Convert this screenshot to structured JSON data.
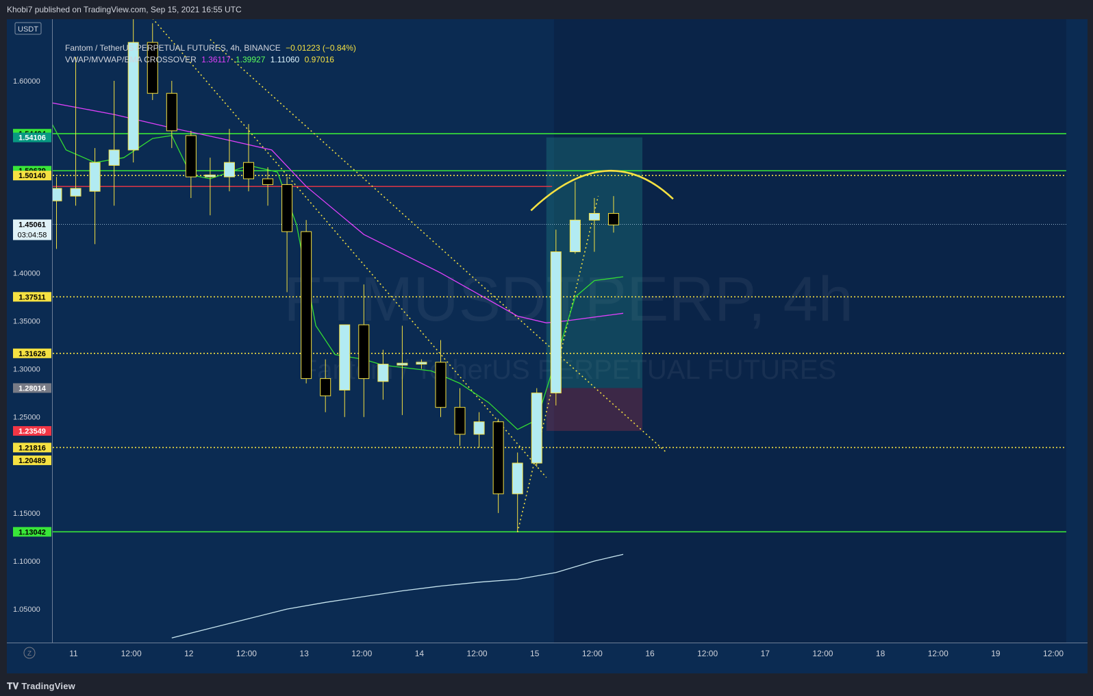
{
  "header": {
    "published": "Khobi7 published on TradingView.com, Sep 15, 2021 16:55 UTC"
  },
  "legend": {
    "currency_badge": "USDT",
    "symbol_line": "Fantom / TetherUS PERPETUAL FUTURES, 4h, BINANCE",
    "change": "−0.01223 (−0.84%)",
    "indicator_name": "VWAP/MVWAP/EMA CROSSOVER",
    "ind_v1": "1.36117",
    "ind_v2": "1.39927",
    "ind_v3": "1.11060",
    "ind_v4": "0.97016"
  },
  "watermark": {
    "symbol": "FTMUSDTPERP, 4h",
    "name": "Fantom / TetherUS PERPETUAL FUTURES"
  },
  "footer": {
    "brand": "TradingView",
    "zoom_label": "Z"
  },
  "colors": {
    "background": "#1e222d",
    "chart_bg": "#0b2b52",
    "candle_up": "#b2ebf2",
    "candle_down": "#000000",
    "candle_border": "#f5e142",
    "vwap": "#e040fb",
    "ema": "#33dd33",
    "mvwap": "#c8e6f0",
    "level_green": "#39e639",
    "level_red": "#f23645",
    "level_yellow": "#f5e142"
  },
  "chart_data": {
    "type": "candlestick",
    "interval": "4h",
    "ylim": [
      1.02,
      1.66
    ],
    "y_ticks": [
      "1.60000",
      "1.40000",
      "1.35000",
      "1.30000",
      "1.25000",
      "1.15000",
      "1.10000",
      "1.05000"
    ],
    "x_ticks": [
      "11",
      "12:00",
      "12",
      "12:00",
      "13",
      "12:00",
      "14",
      "12:00",
      "15",
      "12:00",
      "16",
      "12:00",
      "17",
      "12:00",
      "18",
      "12:00",
      "19",
      "12:00"
    ],
    "candles": [
      {
        "t": 0,
        "o": 1.475,
        "h": 1.5,
        "l": 1.425,
        "c": 1.488
      },
      {
        "t": 1,
        "o": 1.48,
        "h": 1.625,
        "l": 1.47,
        "c": 1.488
      },
      {
        "t": 2,
        "o": 1.485,
        "h": 1.53,
        "l": 1.43,
        "c": 1.515
      },
      {
        "t": 3,
        "o": 1.512,
        "h": 1.6,
        "l": 1.47,
        "c": 1.528
      },
      {
        "t": 4,
        "o": 1.528,
        "h": 1.675,
        "l": 1.515,
        "c": 1.64
      },
      {
        "t": 5,
        "o": 1.64,
        "h": 1.66,
        "l": 1.58,
        "c": 1.587
      },
      {
        "t": 6,
        "o": 1.587,
        "h": 1.6,
        "l": 1.53,
        "c": 1.548
      },
      {
        "t": 7,
        "o": 1.543,
        "h": 1.548,
        "l": 1.478,
        "c": 1.5
      },
      {
        "t": 8,
        "o": 1.5,
        "h": 1.52,
        "l": 1.46,
        "c": 1.502
      },
      {
        "t": 9,
        "o": 1.5,
        "h": 1.55,
        "l": 1.485,
        "c": 1.515
      },
      {
        "t": 10,
        "o": 1.515,
        "h": 1.555,
        "l": 1.485,
        "c": 1.498
      },
      {
        "t": 11,
        "o": 1.498,
        "h": 1.51,
        "l": 1.47,
        "c": 1.492
      },
      {
        "t": 12,
        "o": 1.492,
        "h": 1.5,
        "l": 1.38,
        "c": 1.443
      },
      {
        "t": 13,
        "o": 1.443,
        "h": 1.455,
        "l": 1.285,
        "c": 1.29
      },
      {
        "t": 14,
        "o": 1.29,
        "h": 1.31,
        "l": 1.255,
        "c": 1.272
      },
      {
        "t": 15,
        "o": 1.278,
        "h": 1.345,
        "l": 1.25,
        "c": 1.346
      },
      {
        "t": 16,
        "o": 1.346,
        "h": 1.388,
        "l": 1.25,
        "c": 1.29
      },
      {
        "t": 17,
        "o": 1.287,
        "h": 1.32,
        "l": 1.268,
        "c": 1.305
      },
      {
        "t": 18,
        "o": 1.304,
        "h": 1.345,
        "l": 1.252,
        "c": 1.306
      },
      {
        "t": 19,
        "o": 1.305,
        "h": 1.31,
        "l": 1.3,
        "c": 1.307
      },
      {
        "t": 20,
        "o": 1.307,
        "h": 1.33,
        "l": 1.25,
        "c": 1.26
      },
      {
        "t": 21,
        "o": 1.26,
        "h": 1.28,
        "l": 1.22,
        "c": 1.232
      },
      {
        "t": 22,
        "o": 1.232,
        "h": 1.255,
        "l": 1.218,
        "c": 1.245
      },
      {
        "t": 23,
        "o": 1.245,
        "h": 1.248,
        "l": 1.15,
        "c": 1.17
      },
      {
        "t": 24,
        "o": 1.17,
        "h": 1.213,
        "l": 1.13,
        "c": 1.202
      },
      {
        "t": 25,
        "o": 1.202,
        "h": 1.28,
        "l": 1.198,
        "c": 1.275
      },
      {
        "t": 26,
        "o": 1.275,
        "h": 1.445,
        "l": 1.262,
        "c": 1.422
      },
      {
        "t": 27,
        "o": 1.422,
        "h": 1.495,
        "l": 1.42,
        "c": 1.455
      },
      {
        "t": 28,
        "o": 1.455,
        "h": 1.478,
        "l": 1.422,
        "c": 1.462
      },
      {
        "t": 29,
        "o": 1.462,
        "h": 1.48,
        "l": 1.442,
        "c": 1.45
      }
    ],
    "series": [
      {
        "name": "VWAP",
        "color": "#e040fb",
        "points": [
          [
            -0.5,
            1.578
          ],
          [
            3,
            1.565
          ],
          [
            6,
            1.551
          ],
          [
            9,
            1.538
          ],
          [
            11.2,
            1.528
          ],
          [
            13,
            1.49
          ],
          [
            16,
            1.44
          ],
          [
            20,
            1.4
          ],
          [
            24,
            1.355
          ],
          [
            25.5,
            1.348
          ],
          [
            26.5,
            1.35
          ],
          [
            29.5,
            1.358
          ]
        ]
      },
      {
        "name": "EMA",
        "color": "#33dd33",
        "points": [
          [
            -0.5,
            1.565
          ],
          [
            0.5,
            1.528
          ],
          [
            2,
            1.515
          ],
          [
            3.5,
            1.52
          ],
          [
            5,
            1.54
          ],
          [
            6,
            1.543
          ],
          [
            7,
            1.502
          ],
          [
            8,
            1.498
          ],
          [
            10,
            1.512
          ],
          [
            11.5,
            1.505
          ],
          [
            12.5,
            1.45
          ],
          [
            13.5,
            1.345
          ],
          [
            14.5,
            1.315
          ],
          [
            16,
            1.31
          ],
          [
            17,
            1.304
          ],
          [
            19.5,
            1.298
          ],
          [
            21,
            1.285
          ],
          [
            22.5,
            1.265
          ],
          [
            24,
            1.237
          ],
          [
            25,
            1.247
          ],
          [
            26,
            1.31
          ],
          [
            27,
            1.375
          ],
          [
            28,
            1.392
          ],
          [
            29.5,
            1.396
          ]
        ]
      },
      {
        "name": "MVWAP",
        "color": "#c8e6f0",
        "points": [
          [
            6,
            1.02
          ],
          [
            8,
            1.03
          ],
          [
            10,
            1.04
          ],
          [
            12,
            1.05
          ],
          [
            14,
            1.057
          ],
          [
            16,
            1.063
          ],
          [
            18,
            1.069
          ],
          [
            20,
            1.074
          ],
          [
            22,
            1.078
          ],
          [
            24,
            1.081
          ],
          [
            26,
            1.088
          ],
          [
            28,
            1.1
          ],
          [
            29.5,
            1.107
          ]
        ]
      }
    ],
    "levels": [
      {
        "price": 1.54494,
        "label": "1.54494",
        "style": "solid",
        "color": "#39e639",
        "label_bg": "#39e639",
        "label_fg": "#000000"
      },
      {
        "price": 1.54106,
        "label": "1.54106",
        "style": "badge",
        "label_bg": "#089981",
        "label_fg": "#ffffff"
      },
      {
        "price": 1.50639,
        "label": "1.50639",
        "style": "solid",
        "color": "#39e639",
        "label_bg": "#39e639",
        "label_fg": "#000000"
      },
      {
        "price": 1.5014,
        "label": "1.50140",
        "style": "dotted",
        "color": "#f5e142",
        "label_bg": "#f5e142",
        "label_fg": "#000000"
      },
      {
        "price": 1.45061,
        "label": "1.45061",
        "style": "fine-dotted",
        "color": "#a8c8e0",
        "label_bg": "#e0f2f7",
        "label_fg": "#000000",
        "sublabel": "03:04:58"
      },
      {
        "price": 1.37511,
        "label": "1.37511",
        "style": "dotted",
        "color": "#f5e142",
        "label_bg": "#f5e142",
        "label_fg": "#000000"
      },
      {
        "price": 1.31626,
        "label": "1.31626",
        "style": "dotted",
        "color": "#f5e142",
        "label_bg": "#f5e142",
        "label_fg": "#000000"
      },
      {
        "price": 1.28014,
        "label": "1.28014",
        "style": "badge",
        "label_bg": "#787b86",
        "label_fg": "#ffffff"
      },
      {
        "price": 1.23549,
        "label": "1.23549",
        "style": "badge",
        "label_bg": "#f23645",
        "label_fg": "#ffffff"
      },
      {
        "price": 1.21816,
        "label": "1.21816",
        "style": "dotted",
        "color": "#f5e142",
        "label_bg": "#f5e142",
        "label_fg": "#000000"
      },
      {
        "price": 1.20489,
        "label": "1.20489",
        "style": "badge",
        "label_bg": "#f5e142",
        "label_fg": "#000000"
      },
      {
        "price": 1.13042,
        "label": "1.13042",
        "style": "solid",
        "color": "#39e639",
        "label_bg": "#39e639",
        "label_fg": "#000000"
      }
    ],
    "red_level": {
      "price": 1.49,
      "from_t": -0.5,
      "to_t": 25.8
    },
    "position_tool": {
      "from_t": 25.5,
      "to_t": 30.5,
      "entry": 1.28014,
      "target": 1.54106,
      "stop": 1.23549
    },
    "trendlines": [
      {
        "from": [
          5,
          1.665
        ],
        "to": [
          25.5,
          1.187
        ]
      },
      {
        "from": [
          8,
          1.643
        ],
        "to": [
          31.7,
          1.214
        ]
      },
      {
        "from": [
          24,
          1.13
        ],
        "to": [
          28.2,
          1.48
        ]
      }
    ],
    "arc": {
      "from": [
        24.7,
        1.465
      ],
      "peak": [
        28.7,
        1.507
      ],
      "to": [
        32.1,
        1.477
      ]
    }
  }
}
